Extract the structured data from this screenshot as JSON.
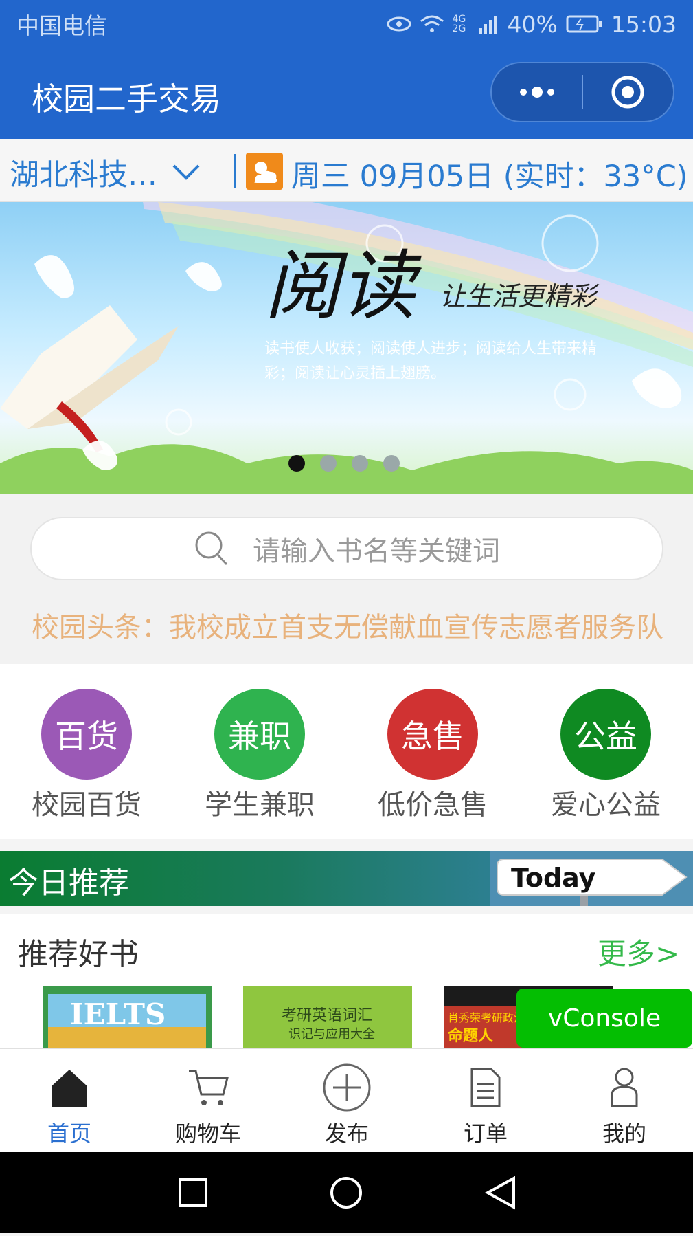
{
  "status_bar": {
    "carrier": "中国电信",
    "network": "4G 2G",
    "battery": "40%",
    "time": "15:03"
  },
  "header": {
    "title": "校园二手交易"
  },
  "info_bar": {
    "school": "湖北科技…",
    "date": "周三 09月05日 (实时：33°C)"
  },
  "banner": {
    "headline": "阅读",
    "tagline": "让生活更精彩",
    "caption_line1": "读书使人收获；阅读使人进步；阅读给人生带来精",
    "caption_line2": "彩；阅读让心灵插上翅膀。",
    "page_count": 4,
    "active_index": 0
  },
  "search": {
    "placeholder": "请输入书名等关键词"
  },
  "headline": {
    "text": "校园头条：我校成立首支无偿献血宣传志愿者服务队"
  },
  "categories": [
    {
      "icon_text": "百货",
      "label": "校园百货",
      "color": "#9b59b6"
    },
    {
      "icon_text": "兼职",
      "label": "学生兼职",
      "color": "#2fb34f"
    },
    {
      "icon_text": "急售",
      "label": "低价急售",
      "color": "#d03232"
    },
    {
      "icon_text": "公益",
      "label": "爱心公益",
      "color": "#0f8a22"
    }
  ],
  "today": {
    "label": "今日推荐",
    "sign": "Today"
  },
  "recommend": {
    "title": "推荐好书",
    "more": "更多>"
  },
  "books": [
    {
      "cover_text": "IELTS"
    },
    {
      "cover_text": "考研英语词汇",
      "cover_sub": "识记与应用大全"
    },
    {
      "cover_text": "肖秀荣考研政治",
      "cover_sub": "命题人"
    }
  ],
  "vconsole": {
    "label": "vConsole"
  },
  "tabbar": [
    {
      "label": "首页",
      "icon": "home-icon",
      "active": true
    },
    {
      "label": "购物车",
      "icon": "cart-icon",
      "active": false
    },
    {
      "label": "发布",
      "icon": "publish-icon",
      "active": false
    },
    {
      "label": "订单",
      "icon": "order-icon",
      "active": false
    },
    {
      "label": "我的",
      "icon": "profile-icon",
      "active": false
    }
  ],
  "colors": {
    "primary": "#2266cc",
    "active_tab": "#2a6fd0",
    "headline": "#e8b27c",
    "more": "#34b94a",
    "vconsole": "#04be02"
  }
}
